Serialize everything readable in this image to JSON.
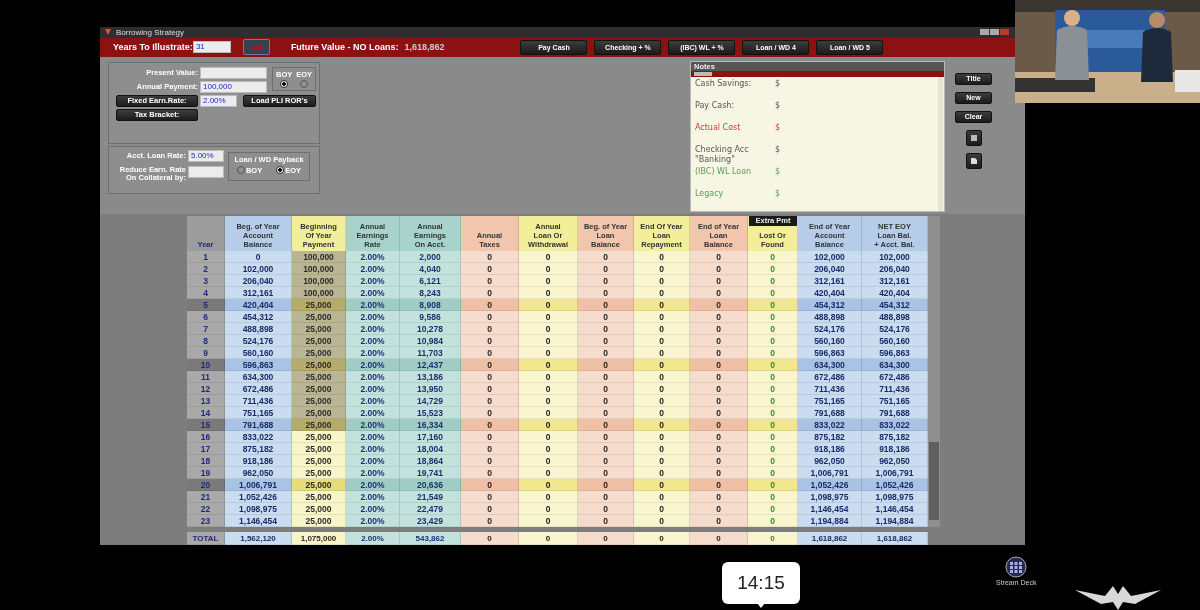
{
  "window": {
    "title": "Borrowing Strategy"
  },
  "toolbar": {
    "years_label": "Years To Illustrate:",
    "years_value": "31",
    "future_label": "Future Value - NO Loans:",
    "future_value": "1,618,862",
    "buttons": [
      "Pay Cash",
      "Checking + %",
      "(IBC) WL + %",
      "Loan / WD 4",
      "Loan / WD 5"
    ]
  },
  "inputs": {
    "present_value_label": "Present Value:",
    "annual_payment_label": "Annual Payment:",
    "annual_payment": "100,000",
    "timing": [
      {
        "label": "BOY",
        "selected": true
      },
      {
        "label": "EOY",
        "selected": false
      }
    ],
    "fixed_rate_button": "Fixed Earn.Rate:",
    "fixed_rate": "2.00%",
    "load_button": "Load PLI ROR's",
    "tax_button": "Tax Bracket:"
  },
  "loan_settings": {
    "loan_rate_label": "Acct. Loan Rate:",
    "loan_rate": "5.00%",
    "reduce_label": "Reduce Earn. Rate\nOn Collateral by:",
    "payback_title": "Loan / WD Payback",
    "payback": [
      {
        "label": "BOY",
        "selected": false
      },
      {
        "label": "EOY",
        "selected": true
      }
    ]
  },
  "notes": {
    "title": "Notes",
    "items": [
      {
        "label": "Cash Savings:",
        "value": "$",
        "kind": "plain"
      },
      {
        "label": "Pay Cash:",
        "value": "$",
        "kind": "plain"
      },
      {
        "label": "Actual Cost",
        "value": "$",
        "kind": "cost"
      },
      {
        "label": "Checking Acc\n\"Banking\"",
        "value": "$",
        "kind": "plain"
      },
      {
        "label": "(IBC) WL Loan",
        "value": "$",
        "kind": "loan"
      },
      {
        "label": "Legacy",
        "value": "$",
        "kind": "loan"
      }
    ]
  },
  "side_buttons": [
    "Title",
    "New",
    "Clear"
  ],
  "table": {
    "columns": [
      {
        "label": "Year",
        "kind": "year"
      },
      {
        "label": "Beg. of Year\nAccount\nBalance",
        "kind": "blue"
      },
      {
        "label": "Beginning\nOf Year\nPayment",
        "kind": "payment"
      },
      {
        "label": "Annual\nEarnings\nRate",
        "kind": "teal"
      },
      {
        "label": "Annual\nEarnings\nOn Acct.",
        "kind": "teal"
      },
      {
        "label": "Annual\nTaxes",
        "kind": "peach"
      },
      {
        "label": "Annual\nLoan Or\nWithdrawal",
        "kind": "yellow"
      },
      {
        "label": "Beg. of Year\nLoan\nBalance",
        "kind": "peach"
      },
      {
        "label": "End Of Year\nLoan\nRepayment",
        "kind": "yellow"
      },
      {
        "label": "End of Year\nLoan\nBalance",
        "kind": "peach"
      },
      {
        "label": "Lost Or\nFound",
        "kind": "found",
        "tab": "Extra Pmt"
      },
      {
        "label": "End of Year\nAccount\nBalance",
        "kind": "blue"
      },
      {
        "label": "NET EOY\nLoan Bal.\n+ Acct. Bal.",
        "kind": "blue"
      }
    ],
    "rows": [
      {
        "cells": [
          "1",
          "0",
          "100,000",
          "2.00%",
          "2,000",
          "0",
          "0",
          "0",
          "0",
          "0",
          "0",
          "102,000",
          "102,000"
        ],
        "highlighted": false,
        "payment_shaded": true
      },
      {
        "cells": [
          "2",
          "102,000",
          "100,000",
          "2.00%",
          "4,040",
          "0",
          "0",
          "0",
          "0",
          "0",
          "0",
          "206,040",
          "206,040"
        ],
        "highlighted": false,
        "payment_shaded": true
      },
      {
        "cells": [
          "3",
          "206,040",
          "100,000",
          "2.00%",
          "6,121",
          "0",
          "0",
          "0",
          "0",
          "0",
          "0",
          "312,161",
          "312,161"
        ],
        "highlighted": false,
        "payment_shaded": true
      },
      {
        "cells": [
          "4",
          "312,161",
          "100,000",
          "2.00%",
          "8,243",
          "0",
          "0",
          "0",
          "0",
          "0",
          "0",
          "420,404",
          "420,404"
        ],
        "highlighted": false,
        "payment_shaded": true
      },
      {
        "cells": [
          "5",
          "420,404",
          "25,000",
          "2.00%",
          "8,908",
          "0",
          "0",
          "0",
          "0",
          "0",
          "0",
          "454,312",
          "454,312"
        ],
        "highlighted": true,
        "payment_shaded": true
      },
      {
        "cells": [
          "6",
          "454,312",
          "25,000",
          "2.00%",
          "9,586",
          "0",
          "0",
          "0",
          "0",
          "0",
          "0",
          "488,898",
          "488,898"
        ],
        "highlighted": false,
        "payment_shaded": true
      },
      {
        "cells": [
          "7",
          "488,898",
          "25,000",
          "2.00%",
          "10,278",
          "0",
          "0",
          "0",
          "0",
          "0",
          "0",
          "524,176",
          "524,176"
        ],
        "highlighted": false,
        "payment_shaded": true
      },
      {
        "cells": [
          "8",
          "524,176",
          "25,000",
          "2.00%",
          "10,984",
          "0",
          "0",
          "0",
          "0",
          "0",
          "0",
          "560,160",
          "560,160"
        ],
        "highlighted": false,
        "payment_shaded": true
      },
      {
        "cells": [
          "9",
          "560,160",
          "25,000",
          "2.00%",
          "11,703",
          "0",
          "0",
          "0",
          "0",
          "0",
          "0",
          "596,863",
          "596,863"
        ],
        "highlighted": false,
        "payment_shaded": true
      },
      {
        "cells": [
          "10",
          "596,863",
          "25,000",
          "2.00%",
          "12,437",
          "0",
          "0",
          "0",
          "0",
          "0",
          "0",
          "634,300",
          "634,300"
        ],
        "highlighted": true,
        "payment_shaded": true
      },
      {
        "cells": [
          "11",
          "634,300",
          "25,000",
          "2.00%",
          "13,186",
          "0",
          "0",
          "0",
          "0",
          "0",
          "0",
          "672,486",
          "672,486"
        ],
        "highlighted": false,
        "payment_shaded": true
      },
      {
        "cells": [
          "12",
          "672,486",
          "25,000",
          "2.00%",
          "13,950",
          "0",
          "0",
          "0",
          "0",
          "0",
          "0",
          "711,436",
          "711,436"
        ],
        "highlighted": false,
        "payment_shaded": true
      },
      {
        "cells": [
          "13",
          "711,436",
          "25,000",
          "2.00%",
          "14,729",
          "0",
          "0",
          "0",
          "0",
          "0",
          "0",
          "751,165",
          "751,165"
        ],
        "highlighted": false,
        "payment_shaded": true
      },
      {
        "cells": [
          "14",
          "751,165",
          "25,000",
          "2.00%",
          "15,523",
          "0",
          "0",
          "0",
          "0",
          "0",
          "0",
          "791,688",
          "791,688"
        ],
        "highlighted": false,
        "payment_shaded": true
      },
      {
        "cells": [
          "15",
          "791,688",
          "25,000",
          "2.00%",
          "16,334",
          "0",
          "0",
          "0",
          "0",
          "0",
          "0",
          "833,022",
          "833,022"
        ],
        "highlighted": true,
        "payment_shaded": true
      },
      {
        "cells": [
          "16",
          "833,022",
          "25,000",
          "2.00%",
          "17,160",
          "0",
          "0",
          "0",
          "0",
          "0",
          "0",
          "875,182",
          "875,182"
        ],
        "highlighted": false,
        "payment_shaded": false
      },
      {
        "cells": [
          "17",
          "875,182",
          "25,000",
          "2.00%",
          "18,004",
          "0",
          "0",
          "0",
          "0",
          "0",
          "0",
          "918,186",
          "918,186"
        ],
        "highlighted": false,
        "payment_shaded": false
      },
      {
        "cells": [
          "18",
          "918,186",
          "25,000",
          "2.00%",
          "18,864",
          "0",
          "0",
          "0",
          "0",
          "0",
          "0",
          "962,050",
          "962,050"
        ],
        "highlighted": false,
        "payment_shaded": false
      },
      {
        "cells": [
          "19",
          "962,050",
          "25,000",
          "2.00%",
          "19,741",
          "0",
          "0",
          "0",
          "0",
          "0",
          "0",
          "1,006,791",
          "1,006,791"
        ],
        "highlighted": false,
        "payment_shaded": false
      },
      {
        "cells": [
          "20",
          "1,006,791",
          "25,000",
          "2.00%",
          "20,636",
          "0",
          "0",
          "0",
          "0",
          "0",
          "0",
          "1,052,426",
          "1,052,426"
        ],
        "highlighted": true,
        "payment_shaded": false
      },
      {
        "cells": [
          "21",
          "1,052,426",
          "25,000",
          "2.00%",
          "21,549",
          "0",
          "0",
          "0",
          "0",
          "0",
          "0",
          "1,098,975",
          "1,098,975"
        ],
        "highlighted": false,
        "payment_shaded": false
      },
      {
        "cells": [
          "22",
          "1,098,975",
          "25,000",
          "2.00%",
          "22,479",
          "0",
          "0",
          "0",
          "0",
          "0",
          "0",
          "1,146,454",
          "1,146,454"
        ],
        "highlighted": false,
        "payment_shaded": false
      },
      {
        "cells": [
          "23",
          "1,146,454",
          "25,000",
          "2.00%",
          "23,429",
          "0",
          "0",
          "0",
          "0",
          "0",
          "0",
          "1,194,884",
          "1,194,884"
        ],
        "highlighted": false,
        "payment_shaded": false
      }
    ],
    "total": [
      "TOTAL",
      "1,562,120",
      "1,075,000",
      "2.00%",
      "543,862",
      "0",
      "0",
      "0",
      "0",
      "0",
      "0",
      "1,618,862",
      "1,618,862"
    ]
  },
  "desktop_icon": "Stream Deck",
  "clock": "14:15"
}
